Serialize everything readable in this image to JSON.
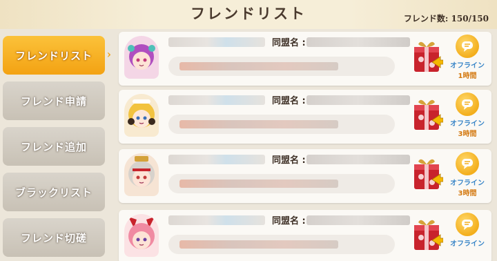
{
  "header": {
    "title": "フレンドリスト",
    "friend_count": "フレンド数: 150/150"
  },
  "sidebar": {
    "items": [
      {
        "label": "フレンドリスト",
        "active": true
      },
      {
        "label": "フレンド申請",
        "active": false
      },
      {
        "label": "フレンド追加",
        "active": false
      },
      {
        "label": "ブラックリスト",
        "active": false
      },
      {
        "label": "フレンド切磋",
        "active": false
      }
    ]
  },
  "friends": [
    {
      "alliance_label": "同盟名 :",
      "status": "オフライン",
      "time": "1時間"
    },
    {
      "alliance_label": "同盟名 :",
      "status": "オフライン",
      "time": "3時間"
    },
    {
      "alliance_label": "同盟名 :",
      "status": "オフライン",
      "time": "3時間"
    },
    {
      "alliance_label": "同盟名 :",
      "status": "オフライン",
      "time": ""
    }
  ],
  "colors": {
    "accent": "#f3a213",
    "status_blue": "#3a86c8",
    "time_orange": "#d47a12",
    "gift_red": "#c8232c"
  },
  "icons": [
    "chevron-right-icon",
    "gift-box-icon",
    "chat-bubble-icon",
    "arrow-left-icon"
  ]
}
